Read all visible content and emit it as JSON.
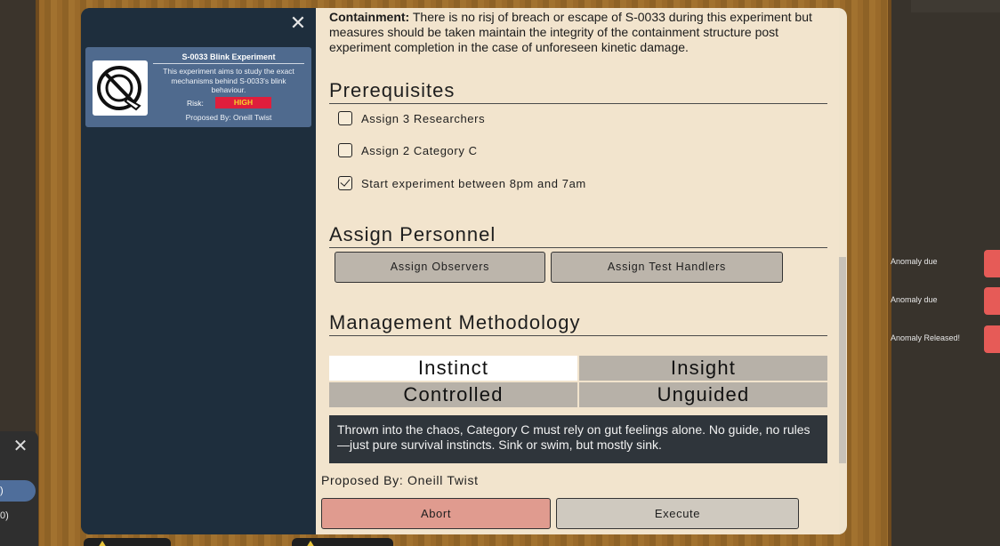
{
  "left_panel": {
    "close_glyph": "✕",
    "items": [
      {
        "label": ")"
      },
      {
        "label": "0)"
      }
    ]
  },
  "notifications": [
    {
      "label": "Anomaly due"
    },
    {
      "label": "Anomaly due"
    },
    {
      "label": "Anomaly Released!"
    }
  ],
  "experiment_card": {
    "title": "S-0033 Blink Experiment",
    "description": "This experiment aims to study the exact mechanisms behind S-0033's blink behaviour.",
    "risk_label": "Risk:",
    "risk_value": "HIGH",
    "proposed_by": "Proposed By:  Oneill Twist",
    "icon": "no-blink-icon"
  },
  "modal": {
    "close_glyph": "✕",
    "containment_label": "Containment:",
    "containment_text": " There is no risj of breach or escape of S-0033 during this experiment but measures should be taken maintain the integrity of the containment structure post experiment completion in the case of unforeseen kinetic damage.",
    "prerequisites": {
      "heading": "Prerequisites",
      "items": [
        {
          "label": "Assign 3 Researchers",
          "checked": false
        },
        {
          "label": "Assign 2 Category C",
          "checked": false
        },
        {
          "label": "Start experiment between 8pm and 7am",
          "checked": true
        }
      ]
    },
    "personnel": {
      "heading": "Assign Personnel",
      "assign_observers": "Assign Observers",
      "assign_test_handlers": "Assign Test Handlers"
    },
    "methodology": {
      "heading": "Management Methodology",
      "options": [
        {
          "label": "Instinct",
          "selected": true
        },
        {
          "label": "Insight",
          "selected": false
        },
        {
          "label": "Controlled",
          "selected": false
        },
        {
          "label": "Unguided",
          "selected": false
        }
      ],
      "description": "Thrown into the chaos, Category C must rely on gut feelings alone. No guide, no rules—just pure survival instincts. Sink or swim, but mostly sink."
    },
    "proposed_by": "Proposed By:  Oneill Twist",
    "abort_label": "Abort",
    "execute_label": "Execute"
  },
  "colors": {
    "modal_side": "#1e2e3d",
    "modal_main": "#f2e4cd",
    "card": "#4f6a8e",
    "risk_high": "#e01e3c",
    "abort": "#e09b8f",
    "execute": "#cfc9bf"
  }
}
